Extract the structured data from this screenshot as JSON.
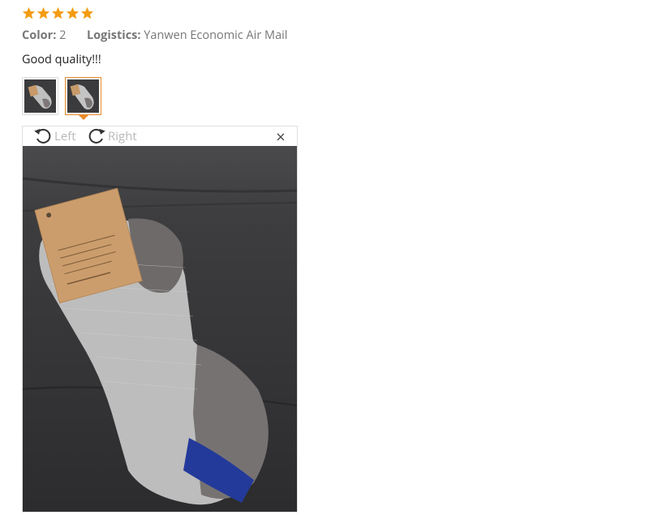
{
  "review": {
    "rating": 5,
    "rating_max": 5,
    "star_color": "#f39c12",
    "color_label": "Color:",
    "color_value": "2",
    "logistics_label": "Logistics:",
    "logistics_value": "Yanwen Economic Air Mail",
    "comment": "Good quality!!!"
  },
  "gallery": {
    "thumbnails": [
      {
        "name": "review-photo-1",
        "selected": false
      },
      {
        "name": "review-photo-2",
        "selected": true
      }
    ],
    "accent_color": "#e88a28"
  },
  "viewer": {
    "rotate_left_label": "Left",
    "rotate_right_label": "Right",
    "close_symbol": "×",
    "icons": [
      "rotate-left-icon",
      "rotate-right-icon",
      "close-icon"
    ]
  }
}
